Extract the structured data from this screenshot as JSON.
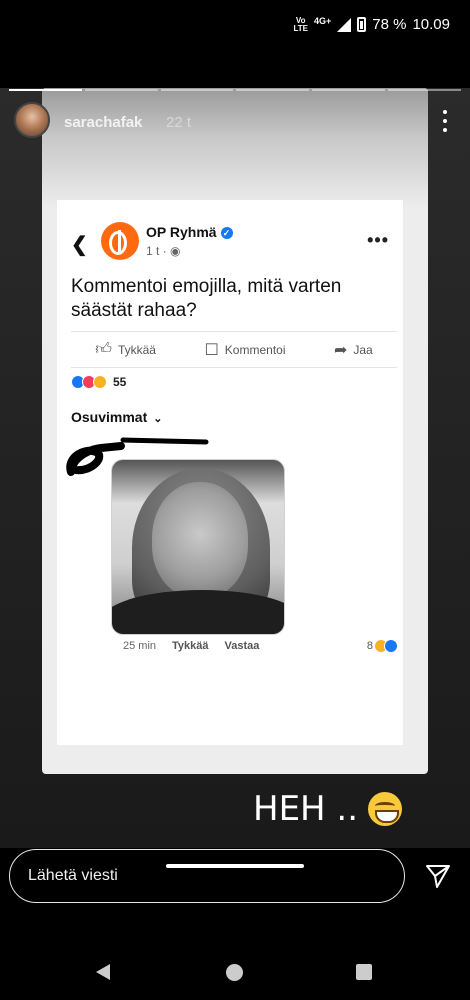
{
  "status_bar": {
    "volte_line1": "Vo",
    "volte_line2": "LTE",
    "network": "4G+",
    "battery": "78 %",
    "time": "10.09"
  },
  "story": {
    "username": "sarachafak",
    "time_ago": "22 t",
    "segments_total": 6,
    "segments_done": 1
  },
  "post": {
    "page_name": "OP Ryhmä",
    "meta": "1 t · ",
    "text": "Kommentoi emojilla, mitä varten säästät rahaa?",
    "actions": {
      "like": "Tykkää",
      "comment": "Kommentoi",
      "share": "Jaa"
    },
    "reaction_count": "55",
    "sort_label": "Osuvimmat",
    "comment": {
      "time": "25 min",
      "like": "Tykkää",
      "reply": "Vastaa",
      "reaction_count": "8"
    }
  },
  "overlay": {
    "text": "HEH .."
  },
  "composer": {
    "placeholder": "Lähetä viesti"
  },
  "icons": {
    "back": "chevron-left-icon",
    "more": "more-horizontal-icon",
    "send": "send-icon",
    "verified": "verified-badge-icon"
  },
  "colors": {
    "op_orange": "#ff6a10",
    "fb_blue": "#1877f2",
    "love_red": "#f33e58",
    "emoji_yellow": "#f8c93a"
  }
}
